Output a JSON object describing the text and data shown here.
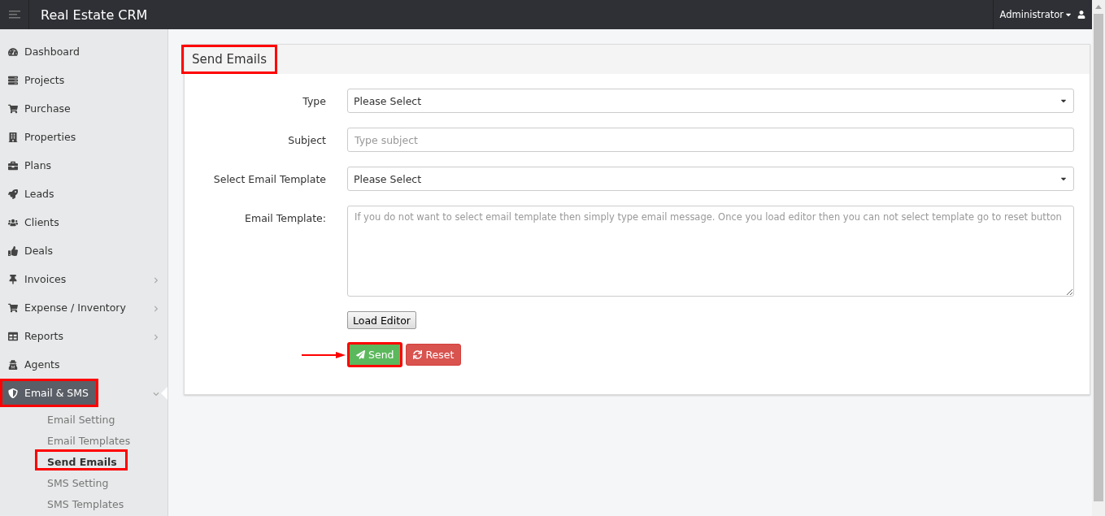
{
  "app": {
    "title": "Real Estate CRM",
    "user": "Administrator"
  },
  "sidebar": {
    "items": [
      {
        "label": "Dashboard",
        "has_submenu": false,
        "selected": false,
        "highlighted": false
      },
      {
        "label": "Projects",
        "has_submenu": false,
        "selected": false,
        "highlighted": false
      },
      {
        "label": "Purchase",
        "has_submenu": false,
        "selected": false,
        "highlighted": false
      },
      {
        "label": "Properties",
        "has_submenu": false,
        "selected": false,
        "highlighted": false
      },
      {
        "label": "Plans",
        "has_submenu": false,
        "selected": false,
        "highlighted": false
      },
      {
        "label": "Leads",
        "has_submenu": false,
        "selected": false,
        "highlighted": false
      },
      {
        "label": "Clients",
        "has_submenu": false,
        "selected": false,
        "highlighted": false
      },
      {
        "label": "Deals",
        "has_submenu": false,
        "selected": false,
        "highlighted": false
      },
      {
        "label": "Invoices",
        "has_submenu": true,
        "selected": false,
        "highlighted": false
      },
      {
        "label": "Expense / Inventory",
        "has_submenu": true,
        "selected": false,
        "highlighted": false
      },
      {
        "label": "Reports",
        "has_submenu": true,
        "selected": false,
        "highlighted": false
      },
      {
        "label": "Agents",
        "has_submenu": false,
        "selected": false,
        "highlighted": false
      },
      {
        "label": "Email & SMS",
        "has_submenu": true,
        "selected": true,
        "highlighted": true,
        "expanded": true,
        "children": [
          {
            "label": "Email Setting",
            "selected": false,
            "highlighted": false
          },
          {
            "label": "Email Templates",
            "selected": false,
            "highlighted": false
          },
          {
            "label": "Send Emails",
            "selected": true,
            "highlighted": true
          },
          {
            "label": "SMS Setting",
            "selected": false,
            "highlighted": false
          },
          {
            "label": "SMS Templates",
            "selected": false,
            "highlighted": false
          }
        ]
      }
    ]
  },
  "panel": {
    "title": "Send Emails",
    "title_highlighted": true,
    "fields": [
      {
        "kind": "select",
        "label": "Type",
        "value": "Please Select"
      },
      {
        "kind": "text",
        "label": "Subject",
        "placeholder": "Type subject"
      },
      {
        "kind": "select",
        "label": "Select Email Template",
        "value": "Please Select"
      },
      {
        "kind": "textarea",
        "label": "Email Template:",
        "placeholder": "If you do not want to select email template then simply type email message. Once you load editor then you can not select template go to reset button"
      }
    ],
    "load_button": "Load Editor",
    "buttons": [
      {
        "kind": "send",
        "label": "Send",
        "highlighted": true,
        "arrow": true
      },
      {
        "kind": "reset",
        "label": "Reset",
        "highlighted": false,
        "arrow": false
      }
    ]
  }
}
